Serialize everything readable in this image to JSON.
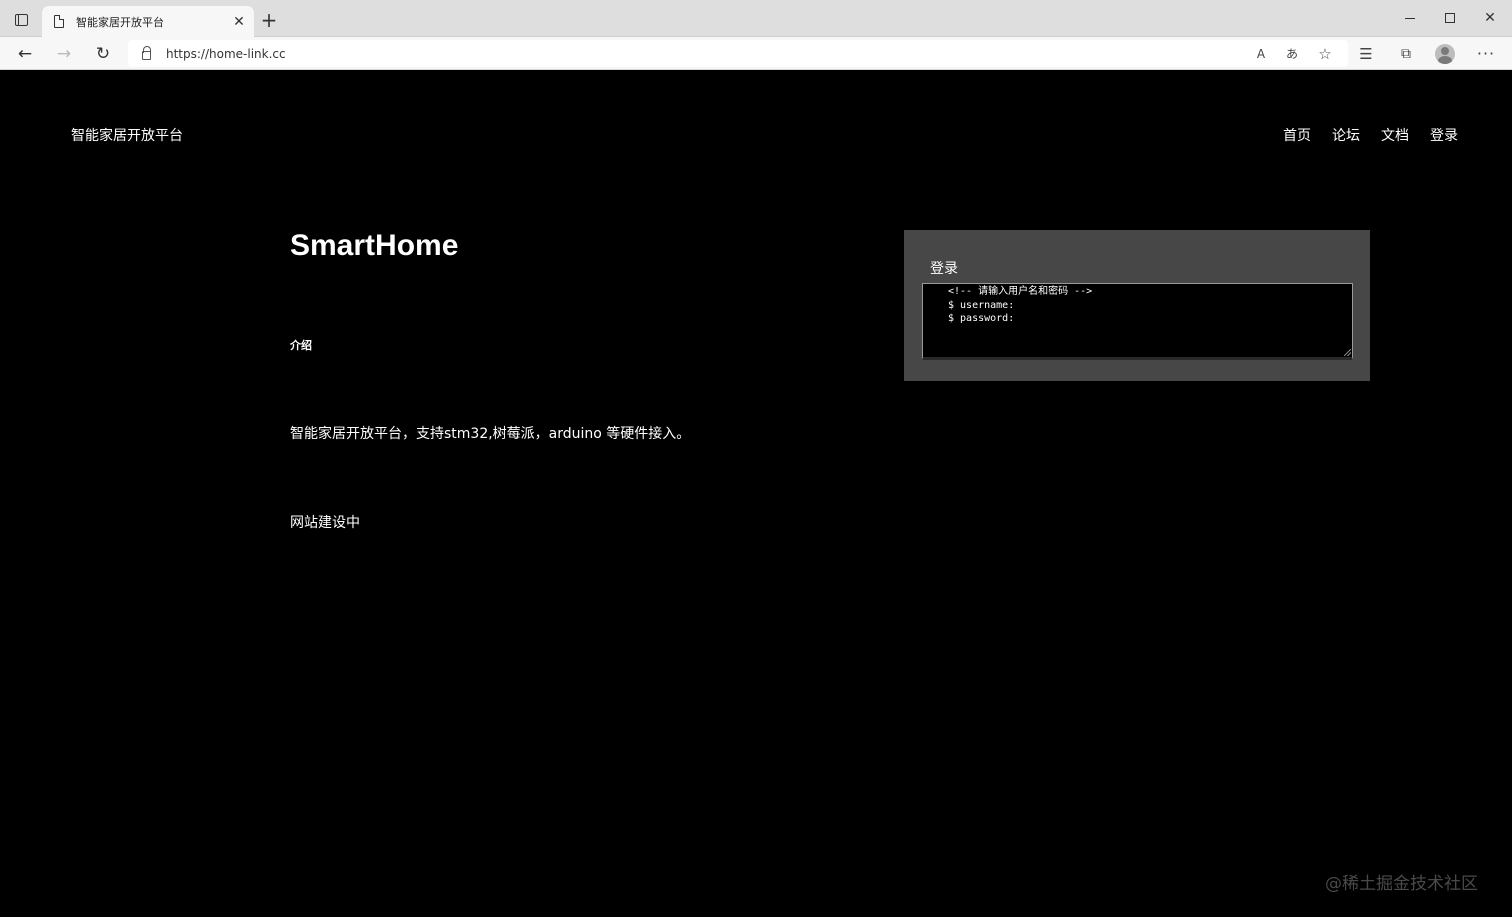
{
  "browser": {
    "tab_title": "智能家居开放平台",
    "tab_close_glyph": "✕",
    "new_tab_glyph": "+",
    "url": "https://home-link.cc",
    "icons": [
      "tab-actions-icon",
      "page-icon",
      "back-icon",
      "forward-icon",
      "reload-icon",
      "lock-icon",
      "read-aloud-icon",
      "translate-icon",
      "add-favorite-icon",
      "favorites-icon",
      "collections-icon",
      "profile-icon",
      "more-icon",
      "minimize-icon",
      "maximize-icon",
      "close-icon"
    ]
  },
  "site": {
    "title": "智能家居开放平台",
    "nav": [
      "首页",
      "论坛",
      "文档",
      "登录"
    ]
  },
  "main": {
    "hero_title": "SmartHome",
    "section_label": "介绍",
    "intro": "智能家居开放平台，支持stm32,树莓派，arduino 等硬件接入。",
    "status": "网站建设中"
  },
  "login": {
    "title": "登录",
    "console_lines": [
      "<!-- 请输入用户名和密码 -->",
      "$ username:",
      "$ password:"
    ]
  },
  "watermark": "@稀土掘金技术社区"
}
